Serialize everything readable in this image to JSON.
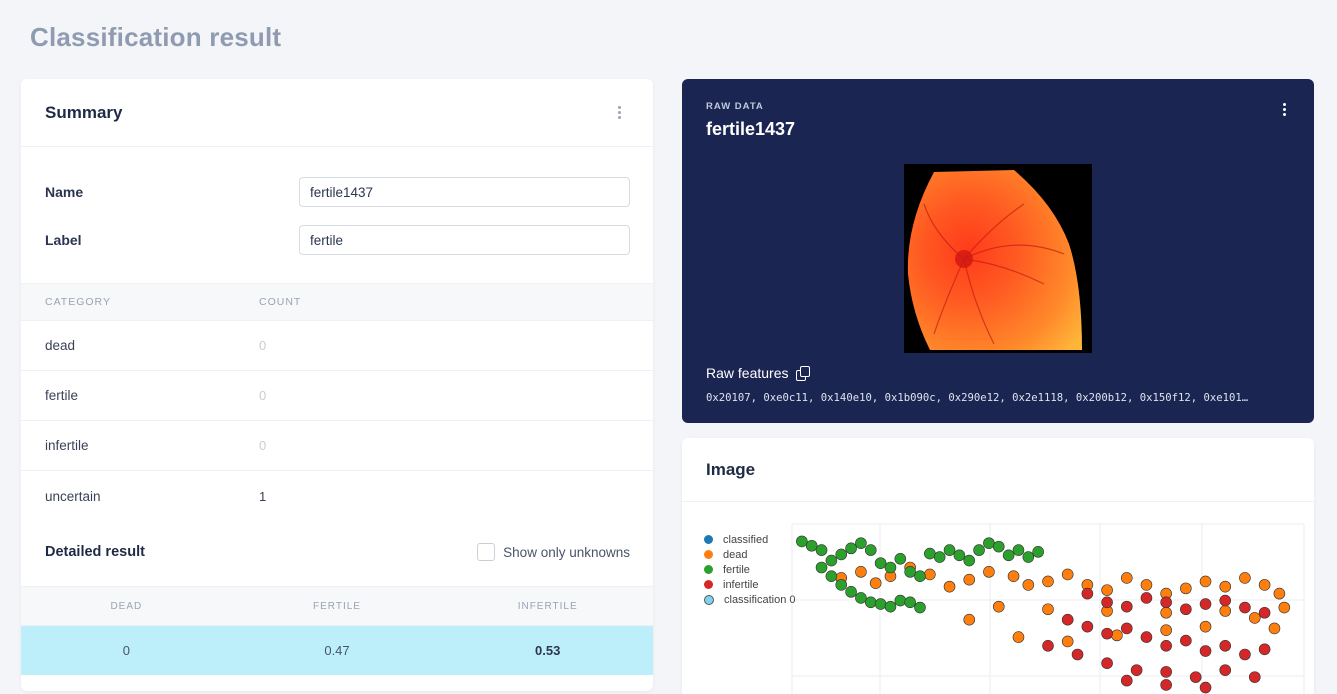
{
  "page": {
    "title": "Classification result"
  },
  "summary": {
    "title": "Summary",
    "fields": [
      {
        "label": "Name",
        "value": "fertile1437"
      },
      {
        "label": "Label",
        "value": "fertile"
      }
    ],
    "category_table": {
      "headers": [
        "CATEGORY",
        "COUNT"
      ],
      "rows": [
        {
          "category": "dead",
          "count": "0"
        },
        {
          "category": "fertile",
          "count": "0"
        },
        {
          "category": "infertile",
          "count": "0"
        },
        {
          "category": "uncertain",
          "count": "1"
        }
      ]
    },
    "detailed": {
      "title": "Detailed result",
      "show_unknowns_label": "Show only unknowns",
      "show_unknowns_checked": false,
      "headers": [
        "DEAD",
        "FERTILE",
        "INFERTILE"
      ],
      "row": [
        "0",
        "0.47",
        "0.53"
      ],
      "row_highlight_color": "#bdeffa"
    }
  },
  "raw": {
    "kicker": "RAW DATA",
    "title": "fertile1437",
    "features_label": "Raw features",
    "features": "0x20107, 0xe0c11, 0x140e10, 0x1b090c, 0x290e12, 0x2e1118, 0x200b12, 0x150f12, 0xe101…",
    "background_color": "#1a2552"
  },
  "image_panel": {
    "title": "Image",
    "legend": [
      {
        "label": "classified",
        "color": "#1f77b4"
      },
      {
        "label": "dead",
        "color": "#ff7f0e"
      },
      {
        "label": "fertile",
        "color": "#2ca02c"
      },
      {
        "label": "infertile",
        "color": "#d62728"
      },
      {
        "label": "classification 0",
        "color": "#7fd3f0"
      }
    ]
  },
  "chart_data": {
    "type": "scatter",
    "series": [
      {
        "name": "classified",
        "points": []
      },
      {
        "name": "dead",
        "points": [
          [
            170,
            62
          ],
          [
            190,
            55
          ],
          [
            205,
            68
          ],
          [
            220,
            60
          ],
          [
            240,
            50
          ],
          [
            260,
            58
          ],
          [
            280,
            72
          ],
          [
            300,
            64
          ],
          [
            320,
            55
          ],
          [
            345,
            60
          ],
          [
            360,
            70
          ],
          [
            380,
            66
          ],
          [
            400,
            58
          ],
          [
            420,
            70
          ],
          [
            440,
            76
          ],
          [
            460,
            62
          ],
          [
            480,
            70
          ],
          [
            500,
            80
          ],
          [
            520,
            74
          ],
          [
            540,
            66
          ],
          [
            560,
            72
          ],
          [
            580,
            62
          ],
          [
            600,
            70
          ],
          [
            615,
            80
          ],
          [
            620,
            96
          ],
          [
            560,
            100
          ],
          [
            500,
            102
          ],
          [
            440,
            100
          ],
          [
            380,
            98
          ],
          [
            330,
            95
          ],
          [
            300,
            110
          ],
          [
            350,
            130
          ],
          [
            400,
            135
          ],
          [
            450,
            128
          ],
          [
            500,
            122
          ],
          [
            540,
            118
          ],
          [
            590,
            108
          ],
          [
            610,
            120
          ]
        ]
      },
      {
        "name": "fertile",
        "points": [
          [
            130,
            20
          ],
          [
            140,
            25
          ],
          [
            150,
            30
          ],
          [
            160,
            42
          ],
          [
            170,
            35
          ],
          [
            180,
            28
          ],
          [
            190,
            22
          ],
          [
            200,
            30
          ],
          [
            210,
            45
          ],
          [
            220,
            50
          ],
          [
            230,
            40
          ],
          [
            240,
            55
          ],
          [
            250,
            60
          ],
          [
            150,
            50
          ],
          [
            160,
            60
          ],
          [
            170,
            70
          ],
          [
            180,
            78
          ],
          [
            190,
            85
          ],
          [
            200,
            90
          ],
          [
            210,
            92
          ],
          [
            220,
            95
          ],
          [
            230,
            88
          ],
          [
            240,
            90
          ],
          [
            250,
            96
          ],
          [
            260,
            34
          ],
          [
            270,
            38
          ],
          [
            280,
            30
          ],
          [
            290,
            36
          ],
          [
            300,
            42
          ],
          [
            310,
            30
          ],
          [
            320,
            22
          ],
          [
            330,
            26
          ],
          [
            340,
            36
          ],
          [
            350,
            30
          ],
          [
            360,
            38
          ],
          [
            370,
            32
          ]
        ]
      },
      {
        "name": "infertile",
        "points": [
          [
            420,
            80
          ],
          [
            440,
            90
          ],
          [
            460,
            95
          ],
          [
            480,
            85
          ],
          [
            500,
            90
          ],
          [
            520,
            98
          ],
          [
            540,
            92
          ],
          [
            560,
            88
          ],
          [
            580,
            96
          ],
          [
            600,
            102
          ],
          [
            400,
            110
          ],
          [
            420,
            118
          ],
          [
            440,
            126
          ],
          [
            460,
            120
          ],
          [
            480,
            130
          ],
          [
            500,
            140
          ],
          [
            520,
            134
          ],
          [
            540,
            146
          ],
          [
            560,
            140
          ],
          [
            580,
            150
          ],
          [
            600,
            144
          ],
          [
            380,
            140
          ],
          [
            410,
            150
          ],
          [
            440,
            160
          ],
          [
            470,
            168
          ],
          [
            500,
            170
          ],
          [
            530,
            176
          ],
          [
            560,
            168
          ],
          [
            590,
            176
          ],
          [
            460,
            180
          ],
          [
            500,
            185
          ],
          [
            540,
            188
          ]
        ]
      },
      {
        "name": "classification 0",
        "points": []
      }
    ]
  }
}
